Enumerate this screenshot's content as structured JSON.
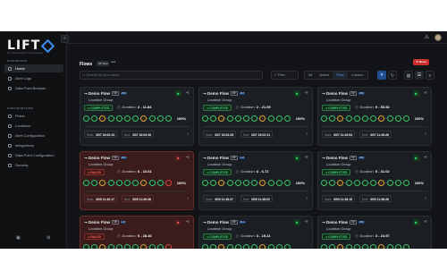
{
  "brand": {
    "name": "LIFT",
    "tagline": "by Fahrenheit Innovation"
  },
  "sidebar": {
    "sections": [
      {
        "label": "DASHBOARD",
        "items": [
          "Home",
          "Alert Logs",
          "Data Point Browser"
        ]
      },
      {
        "label": "CONFIGURATION",
        "items": [
          "Flows",
          "Locations",
          "Alert Configuration",
          "Integrations",
          "Data Point Configuration",
          "Security"
        ]
      }
    ],
    "active": "Home"
  },
  "header": {
    "title": "Flows",
    "count": "38 Total",
    "more": "•••",
    "reset_label": "Reset"
  },
  "toolbar": {
    "search_placeholder": "Search by flow name",
    "filter_label": "Filter",
    "segments": [
      "All",
      "Active",
      "Prior",
      "Custom"
    ],
    "active_segment": "Prior"
  },
  "labels": {
    "duration": "Duration:",
    "start": "Start:",
    "end": "End:",
    "completed": "COMPLETED",
    "failed": "FAILED"
  },
  "cards": [
    {
      "title": "Demo Flow",
      "tag_a": "UP",
      "tag_b": "ABU",
      "location": "Location Group",
      "status": "ok",
      "duration": "2 - 11.84",
      "pct": "100%",
      "start": "3/07 16:03:19",
      "end": "3/07 16:03:30"
    },
    {
      "title": "Demo Flow",
      "tag_a": "UP",
      "tag_b": "NLT",
      "location": "Location Group",
      "status": "ok",
      "duration": "2 - 21.09",
      "pct": "100%",
      "start": "3/07 15:03:33",
      "end": "3/07 15:02:21"
    },
    {
      "title": "Demo Flow",
      "tag_a": "UP",
      "tag_b": "ABU",
      "location": "Location Group",
      "status": "ok",
      "duration": "9 - 53.52",
      "pct": "100%",
      "start": "3/07 11:43:54",
      "end": "3/07 11:49:26"
    },
    {
      "title": "Demo Flow",
      "tag_a": "UP",
      "tag_b": "ABU",
      "location": "Location Group",
      "status": "bad",
      "duration": "6 - 10.61",
      "pct": "100%",
      "start": "3/05 11:40:17",
      "end": "3/05 11:40:26"
    },
    {
      "title": "Demo Flow",
      "tag_a": "UP",
      "tag_b": "LAT",
      "location": "Location Group",
      "status": "ok",
      "duration": "6 - 6.72",
      "pct": "100%",
      "start": "3/05 11:48:37",
      "end": "3/05 11:48:02"
    },
    {
      "title": "Demo Flow",
      "tag_a": "UP",
      "tag_b": "ABU",
      "location": "Location Group",
      "status": "ok",
      "duration": "5 - 31.02",
      "pct": "100%",
      "start": "3/05 11:48:15",
      "end": "3/05 11:48:26"
    },
    {
      "title": "Demo Flow",
      "tag_a": "UP",
      "tag_b": "LAT",
      "location": "Location Group",
      "status": "bad",
      "duration": "5 - 28.40",
      "pct": "",
      "start": "",
      "end": ""
    },
    {
      "title": "Demo Flow",
      "tag_a": "UP",
      "tag_b": "NLA",
      "location": "Location Group",
      "status": "ok",
      "duration": "3 - 19.21",
      "pct": "",
      "start": "",
      "end": ""
    },
    {
      "title": "Demo Flow",
      "tag_a": "UP",
      "tag_b": "ABU",
      "location": "Location Group",
      "status": "ok",
      "duration": "3 - 24.97",
      "pct": "",
      "start": "",
      "end": ""
    }
  ],
  "colors": {
    "accent": "#3b8df0",
    "success": "#39d26b",
    "danger": "#e0443c",
    "background": "#121417"
  }
}
